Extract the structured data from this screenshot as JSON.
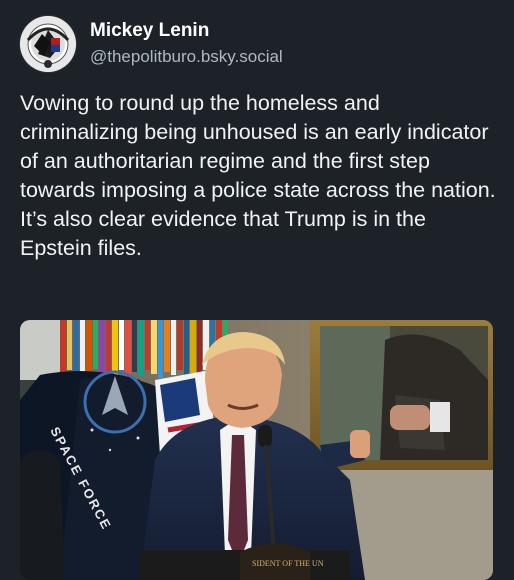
{
  "post": {
    "author": {
      "display_name": "Mickey Lenin",
      "handle": "@thepolitburo.bsky.social"
    },
    "text_paragraphs": [
      "Vowing to round up the homeless and criminalizing being unhoused is an early indicator of an authoritarian regime and the first step towards imposing a police state across the nation.",
      "It’s also clear evidence that Trump is in the Epstein files."
    ]
  },
  "media": {
    "flag_text": "SPACE FORCE",
    "podium_seal_text": "SIDENT OF THE UN"
  },
  "colors": {
    "background": "#1c2228",
    "text_primary": "#f1f3f5",
    "text_secondary": "#aeb9c3"
  }
}
